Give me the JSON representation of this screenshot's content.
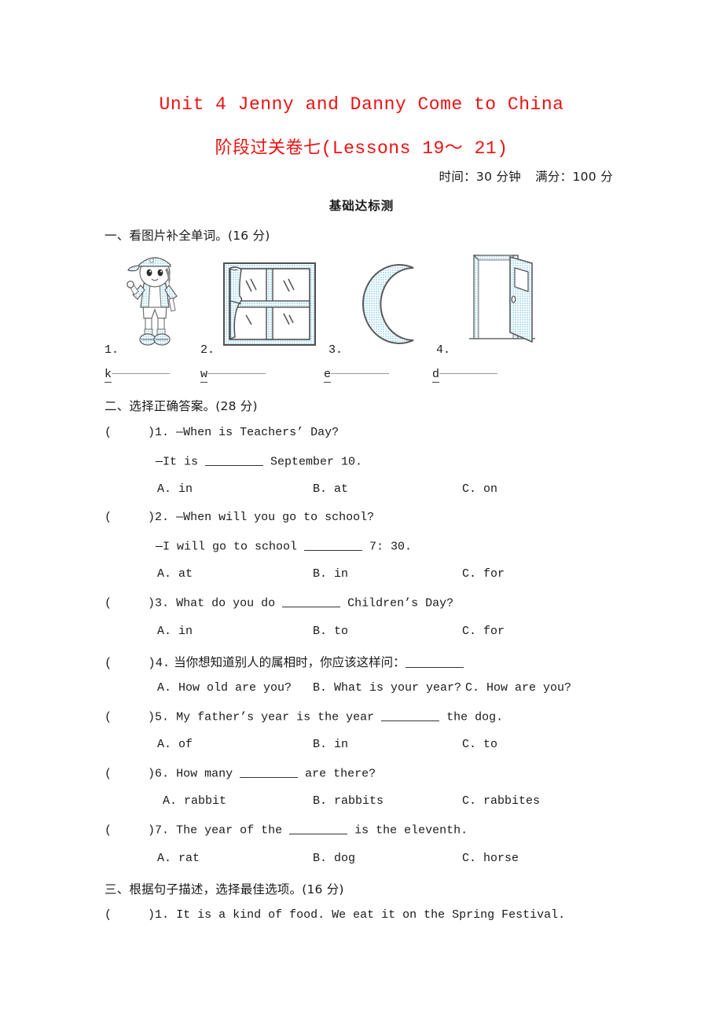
{
  "header": {
    "title_main": "Unit 4 Jenny and Danny Come to China",
    "title_sub_cn": "阶段过关卷七",
    "title_sub_en": "(Lessons 19～ 21)",
    "time_label": "时间：30 分钟",
    "score_label": "满分：100 分",
    "banner": "基础达标测",
    "title_color": "#ee1111"
  },
  "section1": {
    "heading": "一、看图片补全单词。(16 分)",
    "items": [
      {
        "num": "1.",
        "icon": "boy-kid-illustration",
        "prefix": "k"
      },
      {
        "num": "2.",
        "icon": "window-illustration",
        "prefix": "w"
      },
      {
        "num": "3.",
        "icon": "crescent-moon-illustration",
        "prefix": "e"
      },
      {
        "num": "4.",
        "icon": "open-door-illustration",
        "prefix": "d"
      }
    ]
  },
  "section2": {
    "heading": "二、选择正确答案。(28 分)",
    "questions": [
      {
        "paren": "(",
        "paren_close": ")",
        "num": "1.",
        "stem": "—When is Teachers’ Day?",
        "stem2_pre": "—It is ",
        "stem2_post": " September 10.",
        "options": [
          "A. in",
          "B. at",
          "C. on"
        ]
      },
      {
        "paren": "(",
        "paren_close": ")",
        "num": "2.",
        "stem": "—When will you go to school?",
        "stem2_pre": "—I will go to school ",
        "stem2_post": " 7: 30.",
        "options": [
          "A. at",
          "B. in",
          "C. for"
        ]
      },
      {
        "paren": "(",
        "paren_close": ")",
        "num": "3.",
        "stem_pre": "What do you do ",
        "stem_post": " Children’s Day?",
        "options": [
          "A. in",
          "B. to",
          "C. for"
        ]
      },
      {
        "paren": "(",
        "paren_close": ")",
        "num": "4.",
        "stem_cn": "当你想知道别人的属相时，你应该这样问：",
        "options": [
          "A. How old are you?",
          "B. What is your year?",
          "C. How are you?"
        ]
      },
      {
        "paren": "(",
        "paren_close": ")",
        "num": "5.",
        "stem_pre": "My father’s year is the year ",
        "stem_post": " the dog.",
        "options": [
          "A. of",
          "B. in",
          "C. to"
        ]
      },
      {
        "paren": "(",
        "paren_close": ")",
        "num": "6.",
        "stem_pre": "How many ",
        "stem_post": " are there?",
        "options": [
          "A. rabbit",
          "B. rabbits",
          "C. rabbites"
        ]
      },
      {
        "paren": "(",
        "paren_close": ")",
        "num": "7.",
        "stem_pre": "The year of the ",
        "stem_post": " is the eleventh.",
        "options": [
          "A. rat",
          "B. dog",
          "C. horse"
        ]
      }
    ]
  },
  "section3": {
    "heading": "三、根据句子描述，选择最佳选项。(16 分)",
    "questions": [
      {
        "paren": "(",
        "paren_close": ")",
        "num": "1.",
        "stem": "It is a kind of food. We eat it on the Spring Festival."
      }
    ]
  }
}
